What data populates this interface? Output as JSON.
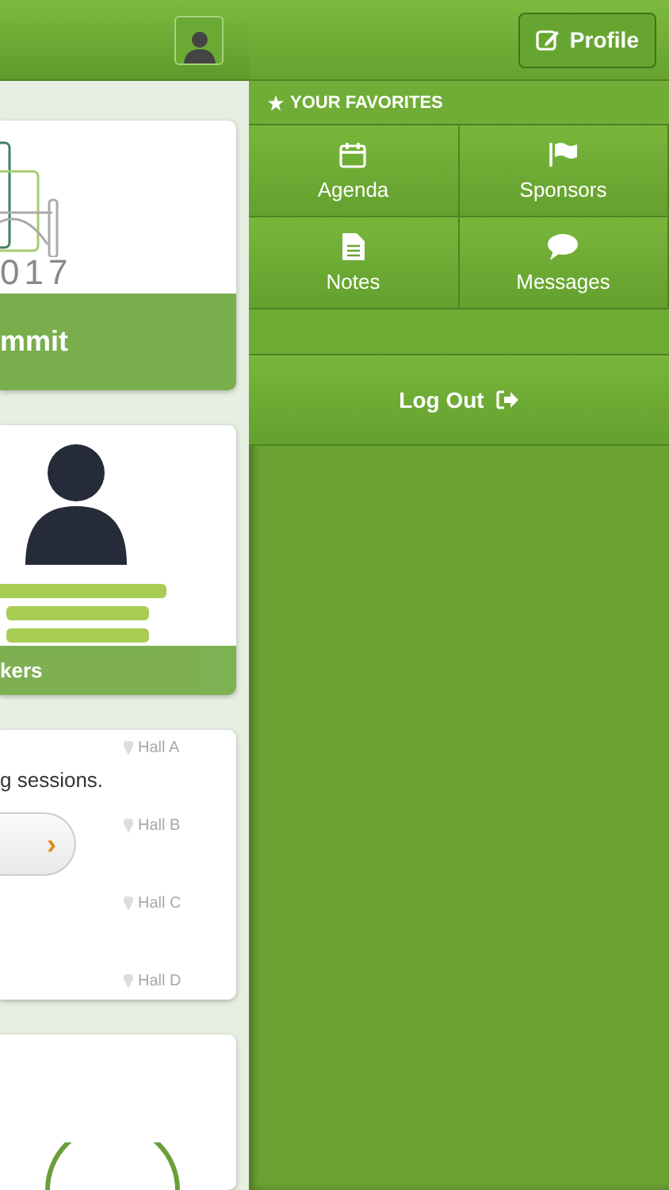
{
  "main": {
    "cards": [
      {
        "kind": "logo",
        "year": "017",
        "footer": "mmit"
      },
      {
        "kind": "speakers",
        "footer": "kers"
      },
      {
        "kind": "sessions",
        "text": "g sessions.",
        "button": "›",
        "halls": [
          "Hall A",
          "Hall B",
          "Hall C",
          "Hall D"
        ]
      },
      {
        "kind": "circle"
      }
    ]
  },
  "menu": {
    "profile_button": "Profile",
    "favorites_heading": "YOUR FAVORITES",
    "favorites": [
      {
        "kind": "calendar",
        "label": "Agenda"
      },
      {
        "kind": "flag",
        "label": "Sponsors"
      },
      {
        "kind": "note",
        "label": "Notes"
      },
      {
        "kind": "chat",
        "label": "Messages"
      }
    ],
    "logout": "Log Out"
  }
}
